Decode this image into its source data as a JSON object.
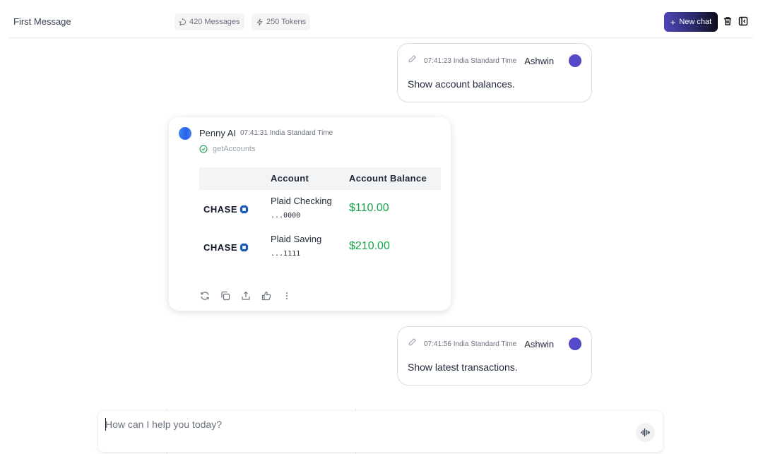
{
  "header": {
    "title": "First Message",
    "messages_count": "420 Messages",
    "tokens_count": "250 Tokens",
    "new_chat_label": "New chat"
  },
  "messages": [
    {
      "role": "user",
      "timestamp": "07:41:23 India Standard Time",
      "author": "Ashwin",
      "text": "Show account balances."
    },
    {
      "role": "assistant",
      "author": "Penny AI",
      "timestamp": "07:41:31 India Standard Time",
      "tool": "getAccounts",
      "table": {
        "headers": [
          "",
          "Account",
          "Account Balance"
        ],
        "rows": [
          {
            "bank": "CHASE",
            "account": "Plaid Checking",
            "mask": "...0000",
            "balance": "$110.00"
          },
          {
            "bank": "CHASE",
            "account": "Plaid Saving",
            "mask": "...1111",
            "balance": "$210.00"
          }
        ]
      },
      "actions": [
        "refresh-icon",
        "copy-icon",
        "share-icon",
        "thumbs-up-icon",
        "more-icon"
      ]
    },
    {
      "role": "user",
      "timestamp": "07:41:56 India Standard Time",
      "author": "Ashwin",
      "text": "Show latest transactions."
    }
  ],
  "composer": {
    "placeholder": "How can I help you today?",
    "value": ""
  },
  "colors": {
    "accent": "#4f46b5",
    "user_avatar": "#5549c9",
    "ai_avatar": "#3b82f6",
    "balance": "#16a34a",
    "chase_blue": "#1a5bb5"
  }
}
